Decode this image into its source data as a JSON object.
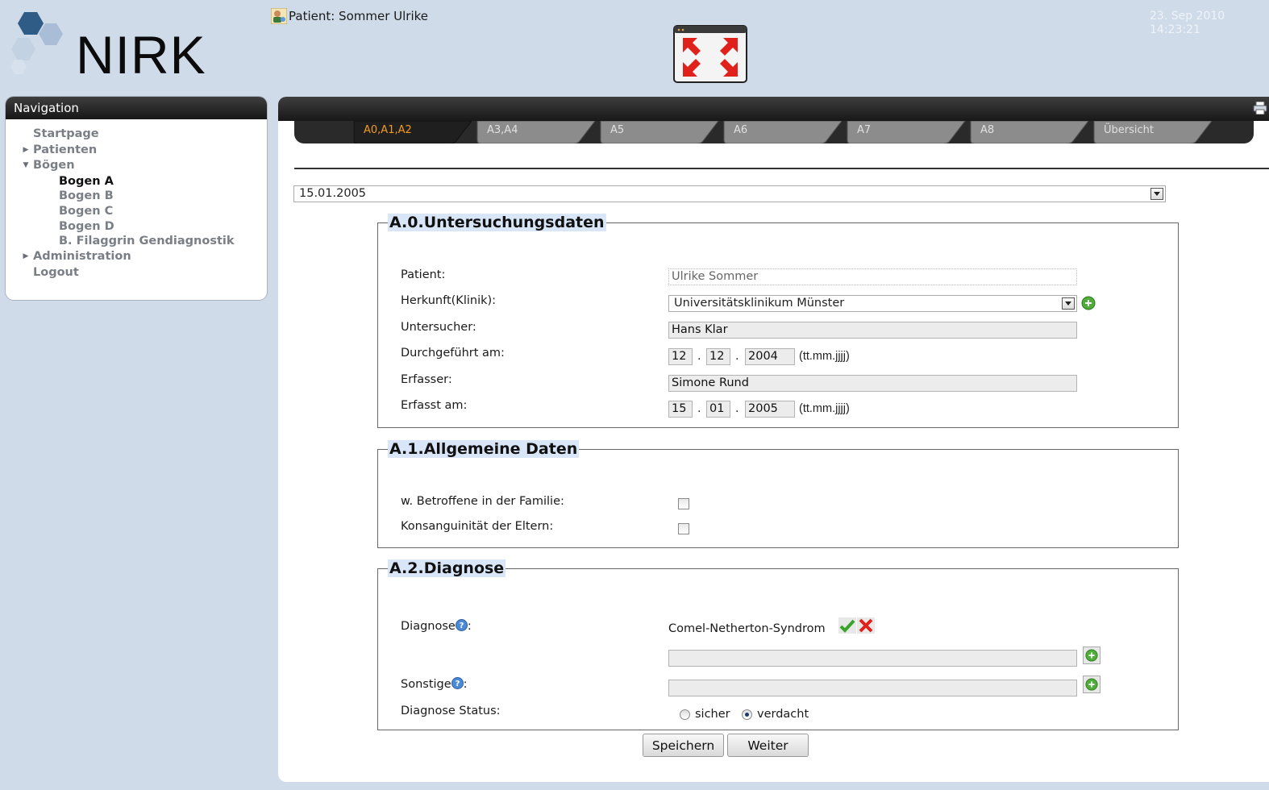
{
  "header": {
    "logo_text": "NIRK",
    "patient_label": "Patient: Sommer Ulrike",
    "date": "23. Sep 2010",
    "time": "14:23:21"
  },
  "navigation": {
    "title": "Navigation",
    "items": [
      {
        "label": "Startpage"
      },
      {
        "label": "Patienten"
      },
      {
        "label": "Bögen"
      },
      {
        "label": "Administration"
      },
      {
        "label": "Logout"
      }
    ],
    "sub_items": [
      {
        "label": "Bogen A"
      },
      {
        "label": "Bogen B"
      },
      {
        "label": "Bogen C"
      },
      {
        "label": "Bogen D"
      },
      {
        "label": "B. Filaggrin Gendiagnostik"
      }
    ]
  },
  "tabs": [
    {
      "label": "A0,A1,A2"
    },
    {
      "label": "A3,A4"
    },
    {
      "label": "A5"
    },
    {
      "label": "A6"
    },
    {
      "label": "A7"
    },
    {
      "label": "A8"
    },
    {
      "label": "Übersicht"
    }
  ],
  "date_select": {
    "value": "15.01.2005"
  },
  "section_a0": {
    "title": "A.0.Untersuchungsdaten",
    "patient_label": "Patient:",
    "patient_value": "Ulrike Sommer",
    "herkunft_label": "Herkunft(Klinik):",
    "herkunft_value": "Universitätsklinikum Münster",
    "untersucher_label": "Untersucher:",
    "untersucher_value": "Hans Klar",
    "durchgefuehrt_label": "Durchgeführt am:",
    "durchgefuehrt_day": "12",
    "durchgefuehrt_month": "12",
    "durchgefuehrt_year": "2004",
    "date_hint": "(tt.mm.jjjj)",
    "date_sep": ".",
    "erfasser_label": "Erfasser:",
    "erfasser_value": "Simone Rund",
    "erfasst_label": "Erfasst am:",
    "erfasst_day": "15",
    "erfasst_month": "01",
    "erfasst_year": "2005"
  },
  "section_a1": {
    "title": "A.1.Allgemeine Daten",
    "betroffene_label": "w. Betroffene in der Familie:",
    "konsanguinitaet_label": "Konsanguinität der Eltern:"
  },
  "section_a2": {
    "title": "A.2.Diagnose",
    "diagnose_label": "Diagnose",
    "diagnose_value": "Comel-Netherton-Syndrom",
    "sonstige_label": "Sonstige",
    "colon": ":",
    "status_label": "Diagnose Status:",
    "status_options": [
      {
        "label": "sicher"
      },
      {
        "label": "verdacht"
      }
    ],
    "status_selected": "verdacht"
  },
  "buttons": {
    "save": "Speichern",
    "next": "Weiter"
  },
  "colors": {
    "background": "#cfdbe8",
    "active_tab_text": "#f29a22",
    "legend_bg": "#d8e6f7"
  }
}
